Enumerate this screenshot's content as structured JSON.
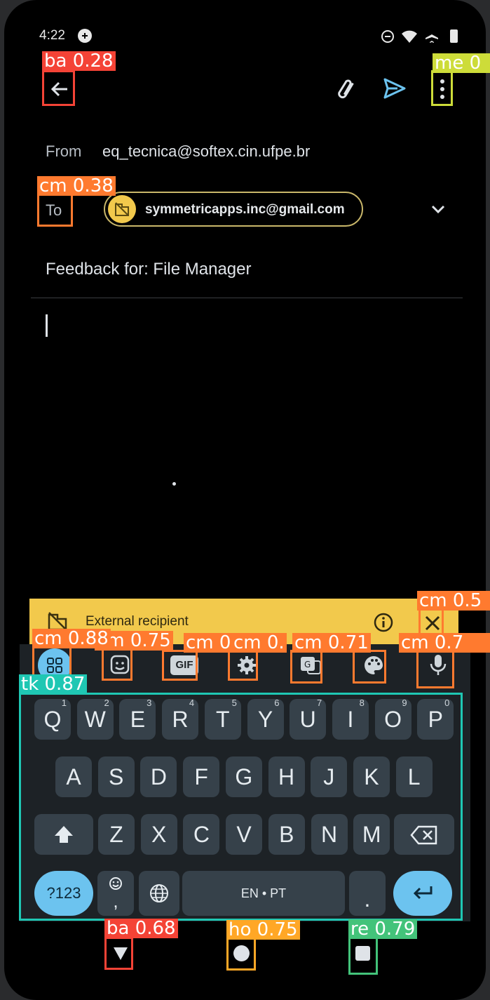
{
  "status_bar": {
    "time": "4:22"
  },
  "email": {
    "from_label": "From",
    "from_value": "eq_tecnica@softex.cin.ufpe.br",
    "to_label": "To",
    "to_chip": "symmetricapps.inc@gmail.com",
    "subject": "Feedback for: File Manager"
  },
  "banner": {
    "text": "External recipient"
  },
  "keyboard": {
    "row1": [
      {
        "k": "Q",
        "n": "1"
      },
      {
        "k": "W",
        "n": "2"
      },
      {
        "k": "E",
        "n": "3"
      },
      {
        "k": "R",
        "n": "4"
      },
      {
        "k": "T",
        "n": "5"
      },
      {
        "k": "Y",
        "n": "6"
      },
      {
        "k": "U",
        "n": "7"
      },
      {
        "k": "I",
        "n": "8"
      },
      {
        "k": "O",
        "n": "9"
      },
      {
        "k": "P",
        "n": "0"
      }
    ],
    "row2": [
      "A",
      "S",
      "D",
      "F",
      "G",
      "H",
      "J",
      "K",
      "L"
    ],
    "row3": [
      "Z",
      "X",
      "C",
      "V",
      "B",
      "N",
      "M"
    ],
    "sym_label": "?123",
    "comma": ",",
    "space_label": "EN • PT",
    "period": ".",
    "gif_label": "GIF"
  },
  "detections": [
    {
      "label": "ba 0.28",
      "color": "#f44336"
    },
    {
      "label": "me 0",
      "color": "#cddc39"
    },
    {
      "label": "cm 0.38",
      "color": "#ff7a2f"
    },
    {
      "label": "cm 0.5",
      "color": "#ff7a2f"
    },
    {
      "label": "cm 0.88",
      "color": "#ff7a2f"
    },
    {
      "label": "cm 0.75",
      "color": "#ff7a2f"
    },
    {
      "label": "cm 0.",
      "color": "#ff7a2f"
    },
    {
      "label": "cm 0.",
      "color": "#ff7a2f"
    },
    {
      "label": "cm 0.71",
      "color": "#ff7a2f"
    },
    {
      "label": "cm 0.7",
      "color": "#ff7a2f"
    },
    {
      "label": "tk 0.87",
      "color": "#1fc7b3"
    },
    {
      "label": "ba 0.68",
      "color": "#f44336"
    },
    {
      "label": "ho 0.75",
      "color": "#ffa726"
    },
    {
      "label": "re 0.79",
      "color": "#43c37a"
    }
  ],
  "colors": {
    "banner": "#f2c94c",
    "chip_border": "#c9b76a",
    "key": "#36414a",
    "accent": "#6cc3ef"
  },
  "icons": [
    "back-arrow-icon",
    "attach-icon",
    "send-icon",
    "more-vert-icon",
    "expand-icon",
    "info-icon",
    "close-icon",
    "apps-grid-icon",
    "sticker-icon",
    "settings-icon",
    "translate-icon",
    "palette-icon",
    "mic-icon",
    "shift-icon",
    "backspace-icon",
    "emoji-icon",
    "globe-icon",
    "enter-icon",
    "nav-back-icon",
    "nav-home-icon",
    "nav-recents-icon"
  ]
}
